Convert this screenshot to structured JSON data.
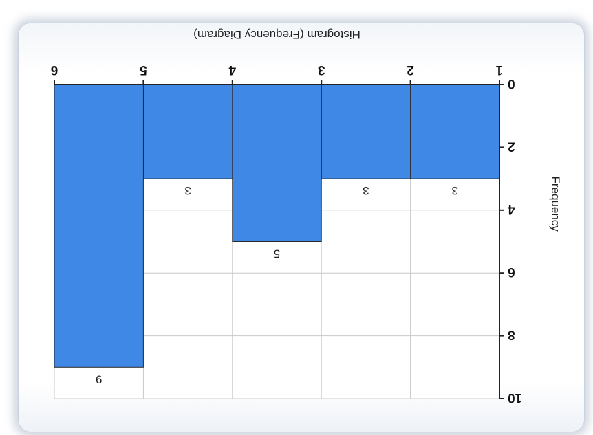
{
  "chart_data": {
    "type": "bar",
    "title": "Histogram (Frequency Diagram)",
    "xlabel": "",
    "ylabel": "Frequency",
    "x_edges": [
      1,
      2,
      3,
      4,
      5,
      6
    ],
    "categories": [
      "1-2",
      "2-3",
      "3-4",
      "4-5",
      "5-6"
    ],
    "values": [
      3,
      3,
      5,
      3,
      9
    ],
    "data_labels": [
      "3",
      "3",
      "5",
      "3",
      "9"
    ],
    "yticks": [
      "0",
      "2",
      "4",
      "6",
      "8",
      "10"
    ],
    "ylim": [
      0,
      10
    ],
    "xlim": [
      1,
      6
    ],
    "grid": true,
    "orientation": "image rotated 180 degrees",
    "bar_color": "#3f88e6",
    "edge_color": "#2a2a2a"
  }
}
